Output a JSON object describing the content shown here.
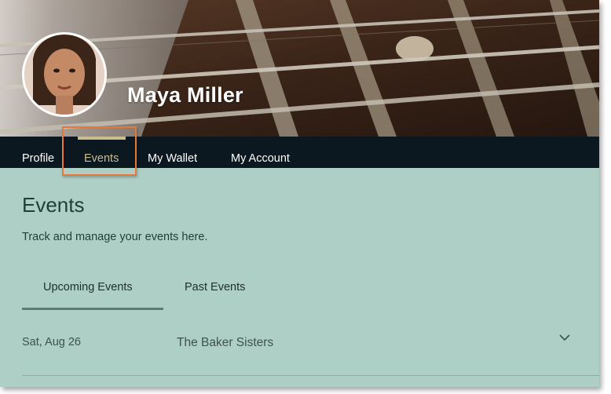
{
  "profile": {
    "name": "Maya Miller"
  },
  "nav": {
    "items": [
      {
        "label": "Profile"
      },
      {
        "label": "Events"
      },
      {
        "label": "My Wallet"
      },
      {
        "label": "My Account"
      }
    ],
    "active": "Events"
  },
  "page": {
    "title": "Events",
    "description": "Track and manage your events here."
  },
  "tabs": [
    {
      "label": "Upcoming Events"
    },
    {
      "label": "Past Events"
    }
  ],
  "active_tab": "Upcoming Events",
  "events": [
    {
      "date": "Sat, Aug 26",
      "title": "The Baker Sisters"
    }
  ],
  "colors": {
    "nav_background": "#0c1820",
    "nav_active": "#c9bd8f",
    "content_background": "#aecfc5",
    "highlight": "#e8783a",
    "text_dark": "#1f4038"
  },
  "icons": {
    "expand": "chevron-down-icon"
  }
}
